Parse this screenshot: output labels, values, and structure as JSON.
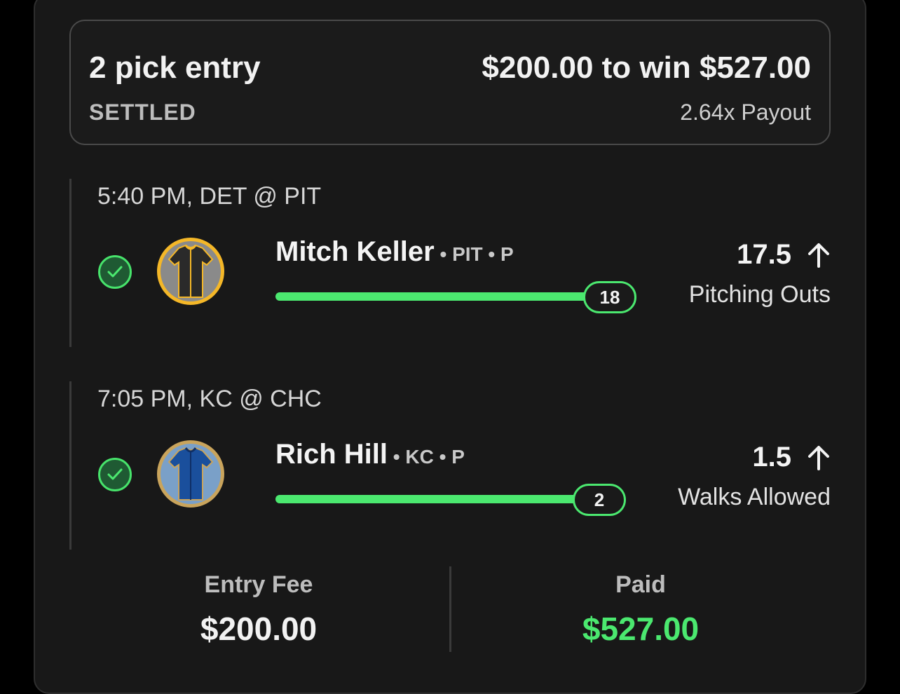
{
  "entry": {
    "title": "2 pick entry",
    "status": "SETTLED",
    "wager_text": "$200.00 to win $527.00",
    "payout_text": "2.64x Payout"
  },
  "picks": [
    {
      "time_matchup": "5:40 PM, DET @ PIT",
      "player": "Mitch Keller",
      "meta": " • PIT • P",
      "line": "17.5",
      "direction": "up-arrow-icon",
      "stat": "Pitching Outs",
      "result": "18",
      "progress": 1.0,
      "jersey_colors": {
        "body": "#2a2a2a",
        "trim": "#f4b728",
        "ring": "#f4b728",
        "bg": "#8a8a8a"
      }
    },
    {
      "time_matchup": "7:05 PM, KC @ CHC",
      "player": "Rich Hill",
      "meta": " • KC • P",
      "line": "1.5",
      "direction": "up-arrow-icon",
      "stat": "Walks Allowed",
      "result": "2",
      "progress": 1.0,
      "jersey_colors": {
        "body": "#1a4f9c",
        "trim": "#c9a45c",
        "ring": "#c9a45c",
        "bg": "#7aa0c8"
      }
    }
  ],
  "footer": {
    "entry_fee_label": "Entry Fee",
    "entry_fee_value": "$200.00",
    "paid_label": "Paid",
    "paid_value": "$527.00"
  },
  "colors": {
    "accent_green": "#4be86f",
    "background": "#181818"
  }
}
